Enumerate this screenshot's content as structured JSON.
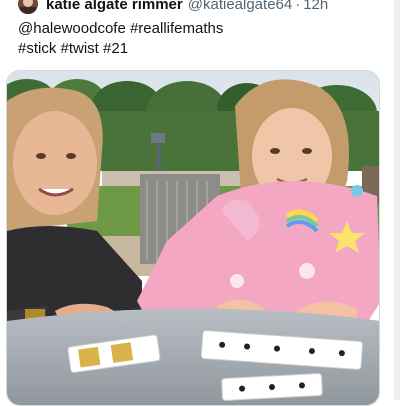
{
  "tweet": {
    "author_name": "katie algate rimmer",
    "author_handle": "@katiealgate64",
    "separator": "·",
    "timestamp": "12h",
    "text_lines": [
      "@halewoodcofe #reallifemaths",
      "#stick #twist #21"
    ]
  },
  "colors": {
    "text_primary": "#0f1419",
    "text_secondary": "#536471",
    "media_border": "#cfd9de",
    "hoodie_pink": "#f4a7c3"
  },
  "media": {
    "subject": "photo"
  }
}
